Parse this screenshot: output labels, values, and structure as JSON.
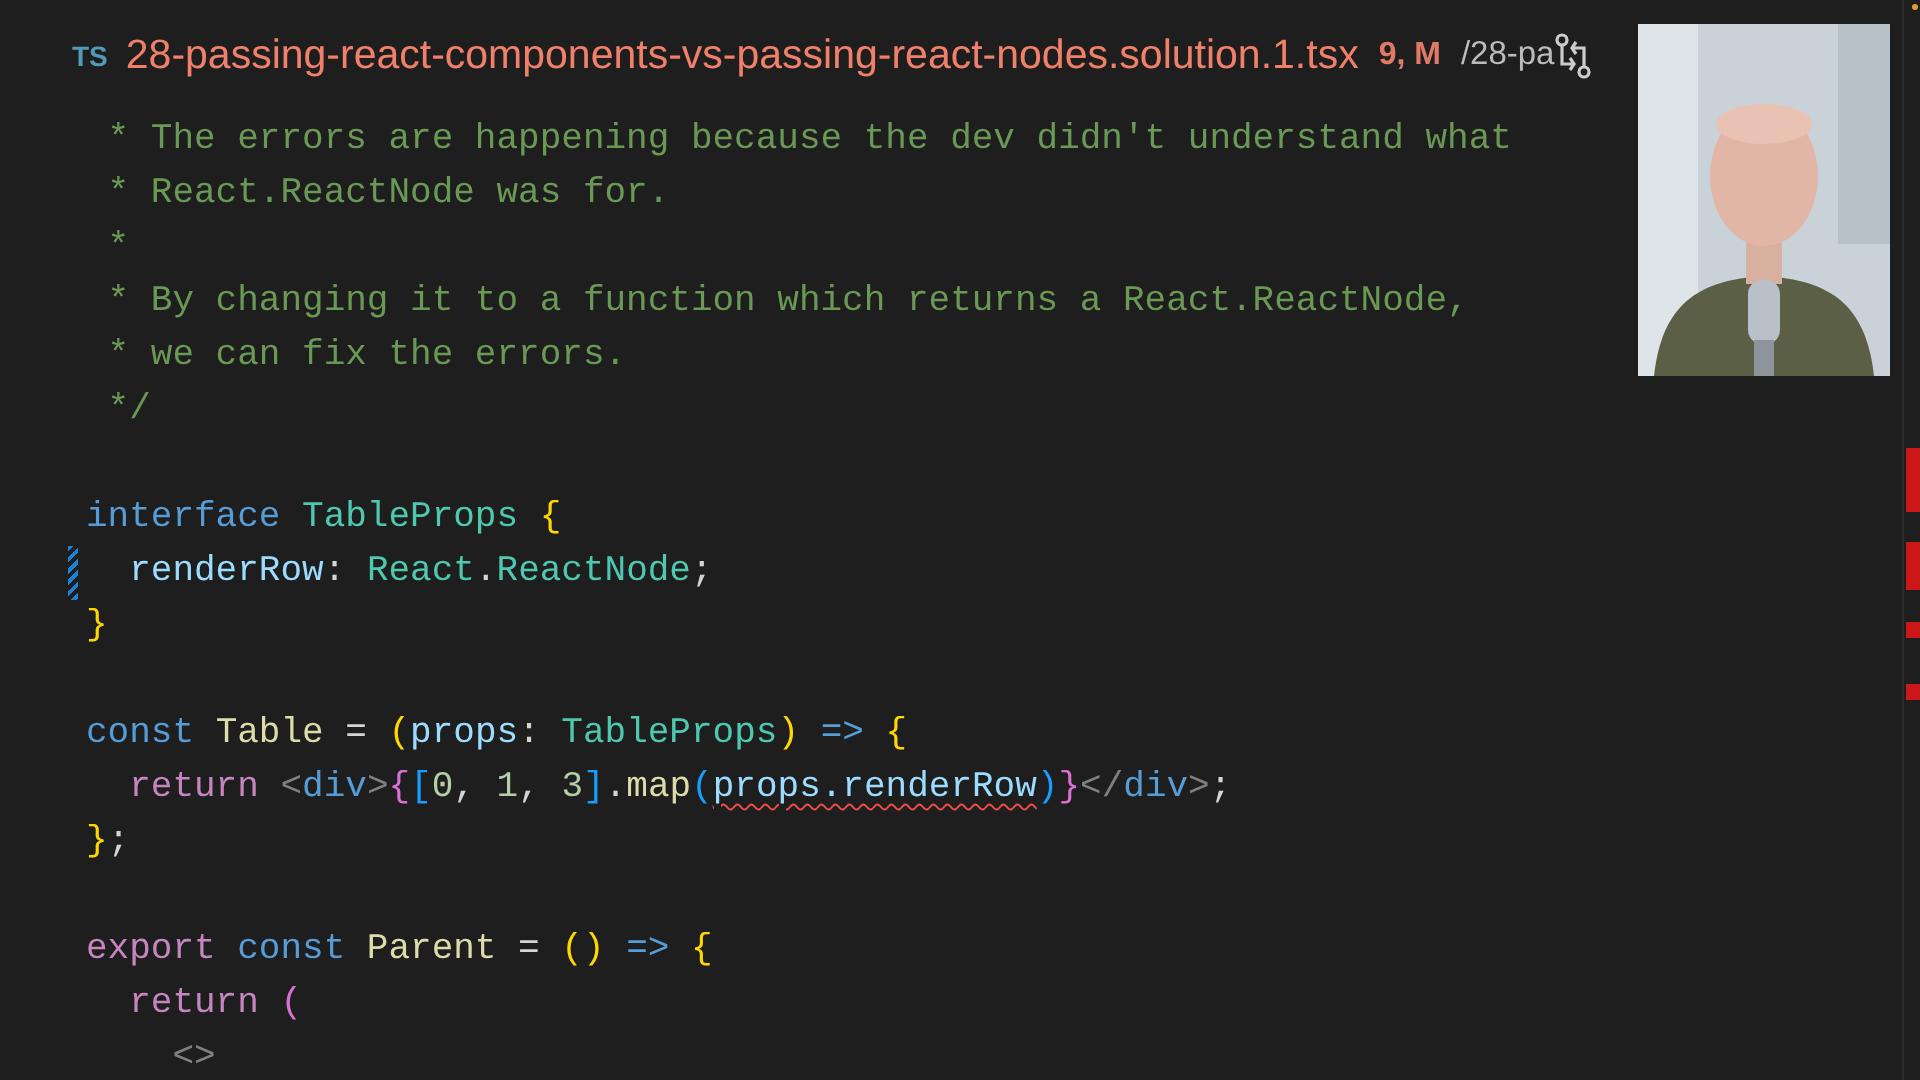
{
  "tab": {
    "language": "TS",
    "filename": "28-passing-react-components-vs-passing-react-nodes.solution.1.tsx",
    "status": "9, M",
    "path": "/28-pa"
  },
  "lines": [
    {
      "kind": "code",
      "tokens": [
        {
          "text": " * The errors are happening because the dev didn't understand what",
          "kind": "comment"
        }
      ]
    },
    {
      "kind": "code",
      "tokens": [
        {
          "text": " * React.ReactNode was for.",
          "kind": "comment"
        }
      ]
    },
    {
      "kind": "code",
      "tokens": [
        {
          "text": " *",
          "kind": "comment"
        }
      ]
    },
    {
      "kind": "code",
      "tokens": [
        {
          "text": " * By changing it to a function which returns a React.ReactNode,",
          "kind": "comment"
        }
      ]
    },
    {
      "kind": "code",
      "tokens": [
        {
          "text": " * we can fix the errors.",
          "kind": "comment"
        }
      ]
    },
    {
      "kind": "code",
      "tokens": [
        {
          "text": " */",
          "kind": "comment"
        }
      ]
    },
    {
      "kind": "blank"
    },
    {
      "kind": "code",
      "tokens": [
        {
          "text": "interface",
          "kind": "keyword"
        },
        {
          "text": " TableProps",
          "kind": "type"
        },
        {
          "text": " {",
          "kind": "brace"
        }
      ]
    },
    {
      "kind": "code",
      "modified": true,
      "tokens": [
        {
          "text": "  renderRow",
          "kind": "variable"
        },
        {
          "text": ": ",
          "kind": "plain"
        },
        {
          "text": "React",
          "kind": "type"
        },
        {
          "text": ".",
          "kind": "plain"
        },
        {
          "text": "ReactNode",
          "kind": "type"
        },
        {
          "text": ";",
          "kind": "plain"
        }
      ]
    },
    {
      "kind": "code",
      "tokens": [
        {
          "text": "}",
          "kind": "brace"
        }
      ]
    },
    {
      "kind": "blank"
    },
    {
      "kind": "code",
      "tokens": [
        {
          "text": "const",
          "kind": "keyword"
        },
        {
          "text": " Table",
          "kind": "function"
        },
        {
          "text": " = ",
          "kind": "plain"
        },
        {
          "text": "(",
          "kind": "brace"
        },
        {
          "text": "props",
          "kind": "variable"
        },
        {
          "text": ": ",
          "kind": "plain"
        },
        {
          "text": "TableProps",
          "kind": "type"
        },
        {
          "text": ")",
          "kind": "brace"
        },
        {
          "text": " =>",
          "kind": "keyword"
        },
        {
          "text": " {",
          "kind": "brace"
        }
      ]
    },
    {
      "kind": "code",
      "tokens": [
        {
          "text": "  return",
          "kind": "control"
        },
        {
          "text": " <",
          "kind": "tag"
        },
        {
          "text": "div",
          "kind": "keyword"
        },
        {
          "text": ">",
          "kind": "tag"
        },
        {
          "text": "{",
          "kind": "paren"
        },
        {
          "text": "[",
          "kind": "bracket"
        },
        {
          "text": "0",
          "kind": "number"
        },
        {
          "text": ", ",
          "kind": "plain"
        },
        {
          "text": "1",
          "kind": "number"
        },
        {
          "text": ", ",
          "kind": "plain"
        },
        {
          "text": "3",
          "kind": "number"
        },
        {
          "text": "]",
          "kind": "bracket"
        },
        {
          "text": ".",
          "kind": "plain"
        },
        {
          "text": "map",
          "kind": "function"
        },
        {
          "text": "(",
          "kind": "bracket"
        },
        {
          "text": "props.renderRow",
          "kind": "variable",
          "error": true
        },
        {
          "text": ")",
          "kind": "bracket"
        },
        {
          "text": "}",
          "kind": "paren"
        },
        {
          "text": "</",
          "kind": "tag"
        },
        {
          "text": "div",
          "kind": "keyword"
        },
        {
          "text": ">",
          "kind": "tag"
        },
        {
          "text": ";",
          "kind": "plain"
        }
      ]
    },
    {
      "kind": "code",
      "tokens": [
        {
          "text": "}",
          "kind": "brace"
        },
        {
          "text": ";",
          "kind": "plain"
        }
      ]
    },
    {
      "kind": "blank"
    },
    {
      "kind": "code",
      "tokens": [
        {
          "text": "export",
          "kind": "control"
        },
        {
          "text": " const",
          "kind": "keyword"
        },
        {
          "text": " Parent",
          "kind": "function"
        },
        {
          "text": " = ",
          "kind": "plain"
        },
        {
          "text": "()",
          "kind": "brace"
        },
        {
          "text": " =>",
          "kind": "keyword"
        },
        {
          "text": " {",
          "kind": "brace"
        }
      ]
    },
    {
      "kind": "code",
      "tokens": [
        {
          "text": "  return",
          "kind": "control"
        },
        {
          "text": " (",
          "kind": "paren"
        }
      ]
    },
    {
      "kind": "code",
      "tokens": [
        {
          "text": "    <>",
          "kind": "tag"
        }
      ]
    }
  ]
}
